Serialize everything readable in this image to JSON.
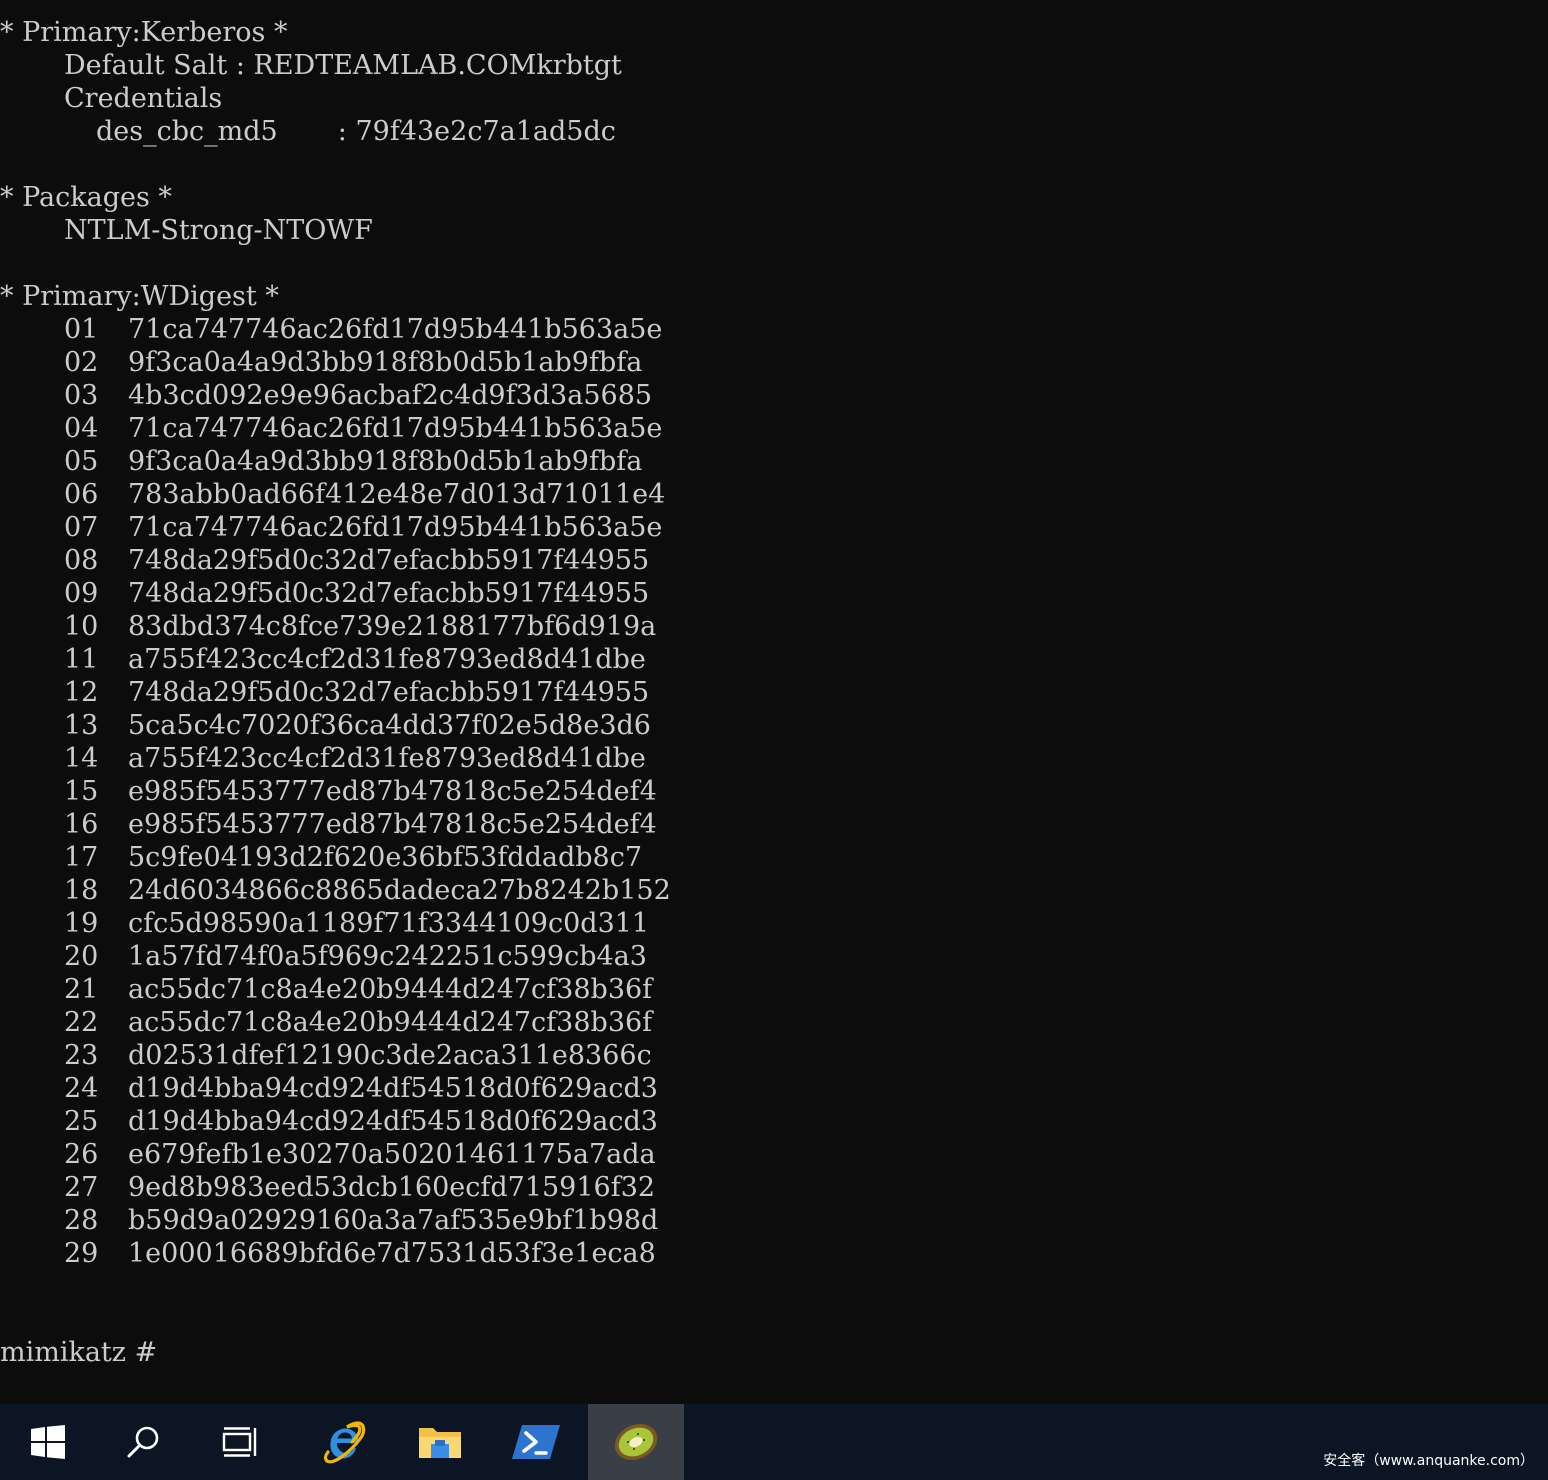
{
  "console": {
    "kerberos": {
      "header": "* Primary:Kerberos *",
      "default_salt": "Default Salt : REDTEAMLAB.COMkrbtgt",
      "credentials_label": "Credentials",
      "des_cbc_md5": "des_cbc_md5       : 79f43e2c7a1ad5dc"
    },
    "packages": {
      "header": "* Packages *",
      "value": "NTLM-Strong-NTOWF"
    },
    "wdigest": {
      "header": "* Primary:WDigest *",
      "entries": [
        {
          "idx": "01",
          "hash": "71ca747746ac26fd17d95b441b563a5e"
        },
        {
          "idx": "02",
          "hash": "9f3ca0a4a9d3bb918f8b0d5b1ab9fbfa"
        },
        {
          "idx": "03",
          "hash": "4b3cd092e9e96acbaf2c4d9f3d3a5685"
        },
        {
          "idx": "04",
          "hash": "71ca747746ac26fd17d95b441b563a5e"
        },
        {
          "idx": "05",
          "hash": "9f3ca0a4a9d3bb918f8b0d5b1ab9fbfa"
        },
        {
          "idx": "06",
          "hash": "783abb0ad66f412e48e7d013d71011e4"
        },
        {
          "idx": "07",
          "hash": "71ca747746ac26fd17d95b441b563a5e"
        },
        {
          "idx": "08",
          "hash": "748da29f5d0c32d7efacbb5917f44955"
        },
        {
          "idx": "09",
          "hash": "748da29f5d0c32d7efacbb5917f44955"
        },
        {
          "idx": "10",
          "hash": "83dbd374c8fce739e2188177bf6d919a"
        },
        {
          "idx": "11",
          "hash": "a755f423cc4cf2d31fe8793ed8d41dbe"
        },
        {
          "idx": "12",
          "hash": "748da29f5d0c32d7efacbb5917f44955"
        },
        {
          "idx": "13",
          "hash": "5ca5c4c7020f36ca4dd37f02e5d8e3d6"
        },
        {
          "idx": "14",
          "hash": "a755f423cc4cf2d31fe8793ed8d41dbe"
        },
        {
          "idx": "15",
          "hash": "e985f5453777ed87b47818c5e254def4"
        },
        {
          "idx": "16",
          "hash": "e985f5453777ed87b47818c5e254def4"
        },
        {
          "idx": "17",
          "hash": "5c9fe04193d2f620e36bf53fddadb8c7"
        },
        {
          "idx": "18",
          "hash": "24d6034866c8865dadeca27b8242b152"
        },
        {
          "idx": "19",
          "hash": "cfc5d98590a1189f71f3344109c0d311"
        },
        {
          "idx": "20",
          "hash": "1a57fd74f0a5f969c242251c599cb4a3"
        },
        {
          "idx": "21",
          "hash": "ac55dc71c8a4e20b9444d247cf38b36f"
        },
        {
          "idx": "22",
          "hash": "ac55dc71c8a4e20b9444d247cf38b36f"
        },
        {
          "idx": "23",
          "hash": "d02531dfef12190c3de2aca311e8366c"
        },
        {
          "idx": "24",
          "hash": "d19d4bba94cd924df54518d0f629acd3"
        },
        {
          "idx": "25",
          "hash": "d19d4bba94cd924df54518d0f629acd3"
        },
        {
          "idx": "26",
          "hash": "e679fefb1e30270a50201461175a7ada"
        },
        {
          "idx": "27",
          "hash": "9ed8b983eed53dcb160ecfd715916f32"
        },
        {
          "idx": "28",
          "hash": "b59d9a02929160a3a7af535e9bf1b98d"
        },
        {
          "idx": "29",
          "hash": "1e00016689bfd6e7d7531d53f3e1eca8"
        }
      ]
    },
    "prompt": "mimikatz #"
  },
  "taskbar": {
    "items": [
      {
        "name": "start-button",
        "icon": "windows-logo-icon"
      },
      {
        "name": "search-button",
        "icon": "search-icon"
      },
      {
        "name": "task-view-button",
        "icon": "task-view-icon"
      },
      {
        "name": "internet-explorer-button",
        "icon": "internet-explorer-icon"
      },
      {
        "name": "file-explorer-button",
        "icon": "folder-icon"
      },
      {
        "name": "powershell-button",
        "icon": "powershell-icon"
      },
      {
        "name": "mimikatz-button",
        "icon": "kiwi-icon",
        "active": true
      }
    ],
    "watermark": "安全客（www.anquanke.com）"
  },
  "colors": {
    "console_background": "#0c0c0c",
    "console_text": "#cccccc",
    "taskbar_background": "#0b1523",
    "active_item": "#3a3f47"
  }
}
